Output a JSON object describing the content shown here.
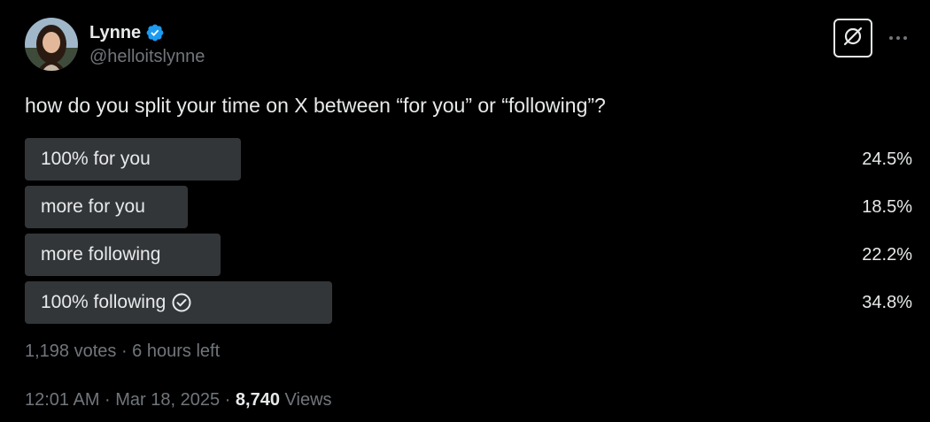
{
  "author": {
    "name": "Lynne",
    "handle": "@helloitslynne"
  },
  "icons": {
    "verified": "verified-badge-icon",
    "grok": "grok-icon",
    "more": "more-horizontal-icon",
    "check": "check-circle-icon"
  },
  "colors": {
    "background": "#000000",
    "text": "#e7e9ea",
    "secondary_text": "#71767b",
    "poll_bar": "#333639",
    "verified": "#1d9bf0"
  },
  "tweet": {
    "text": "how do you split your time on X between “for you” or “following”?"
  },
  "poll": {
    "options": [
      {
        "label": "100% for you",
        "percent": "24.5%",
        "value": 24.5
      },
      {
        "label": "more for you",
        "percent": "18.5%",
        "value": 18.5
      },
      {
        "label": "more following",
        "percent": "22.2%",
        "value": 22.2
      },
      {
        "label": "100% following",
        "percent": "34.8%",
        "value": 34.8,
        "winner": true
      }
    ],
    "meta": "1,198 votes · 6 hours left"
  },
  "footer": {
    "time": "12:01 AM · Mar 18, 2025 · ",
    "views_count": "8,740",
    "views_label": " Views"
  }
}
